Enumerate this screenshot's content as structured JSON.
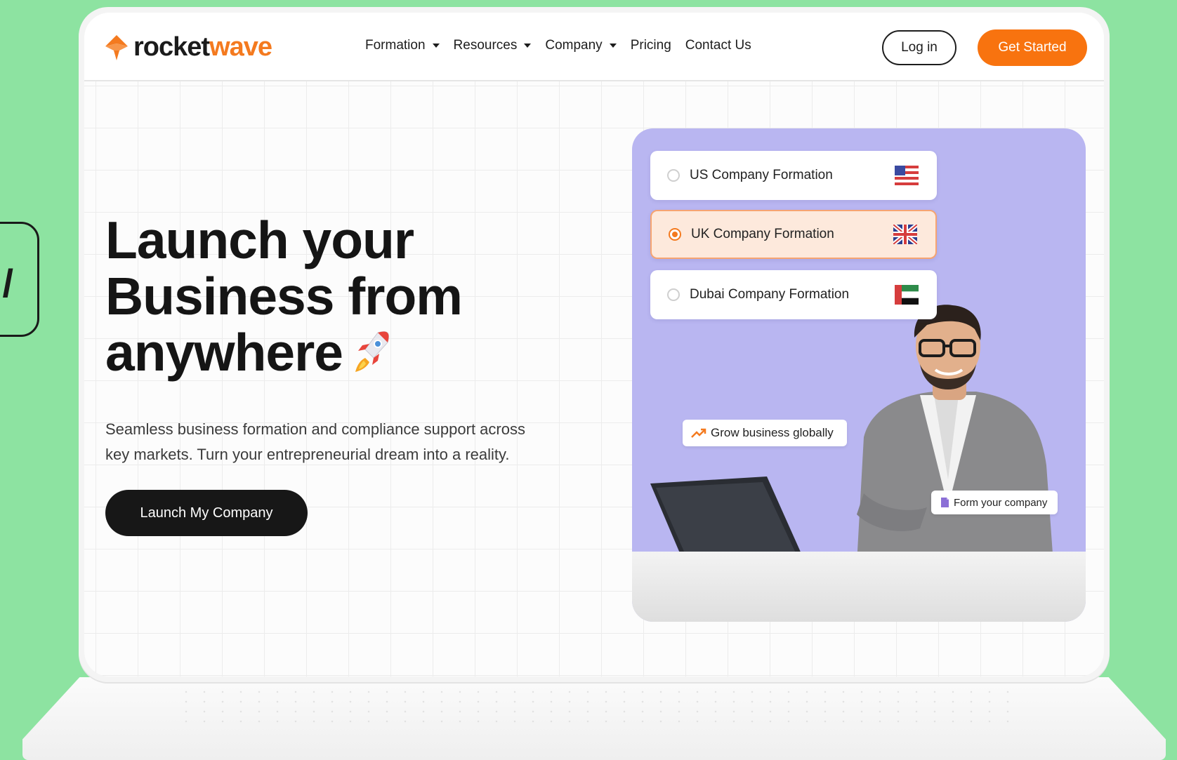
{
  "brand": {
    "logo_text_dark": "rocket",
    "logo_text_accent": "wave",
    "accent_color": "#f47a1f",
    "background_color": "#8de3a1"
  },
  "nav": {
    "items": [
      {
        "label": "Formation",
        "has_dropdown": true
      },
      {
        "label": "Resources",
        "has_dropdown": true
      },
      {
        "label": "Company",
        "has_dropdown": true
      },
      {
        "label": "Pricing",
        "has_dropdown": false
      },
      {
        "label": "Contact Us",
        "has_dropdown": false
      }
    ],
    "login_label": "Log in",
    "get_started_label": "Get Started"
  },
  "hero": {
    "title_line1": "Launch your",
    "title_line2": "Business from",
    "title_line3": "anywhere",
    "title_icon": "rocket-icon",
    "subtitle_line1": "Seamless business formation and compliance support across",
    "subtitle_line2": "key markets. Turn your entrepreneurial dream into a reality.",
    "cta_label": "Launch My Company"
  },
  "formation_options": [
    {
      "label": "US Company Formation",
      "selected": false,
      "flag": "us-flag-icon"
    },
    {
      "label": "UK Company Formation",
      "selected": true,
      "flag": "uk-flag-icon"
    },
    {
      "label": "Dubai Company Formation",
      "selected": false,
      "flag": "uae-flag-icon"
    }
  ],
  "chips": {
    "grow": {
      "label": "Grow business globally",
      "icon": "trending-up-icon"
    },
    "form": {
      "label": "Form your company",
      "icon": "document-icon"
    }
  }
}
